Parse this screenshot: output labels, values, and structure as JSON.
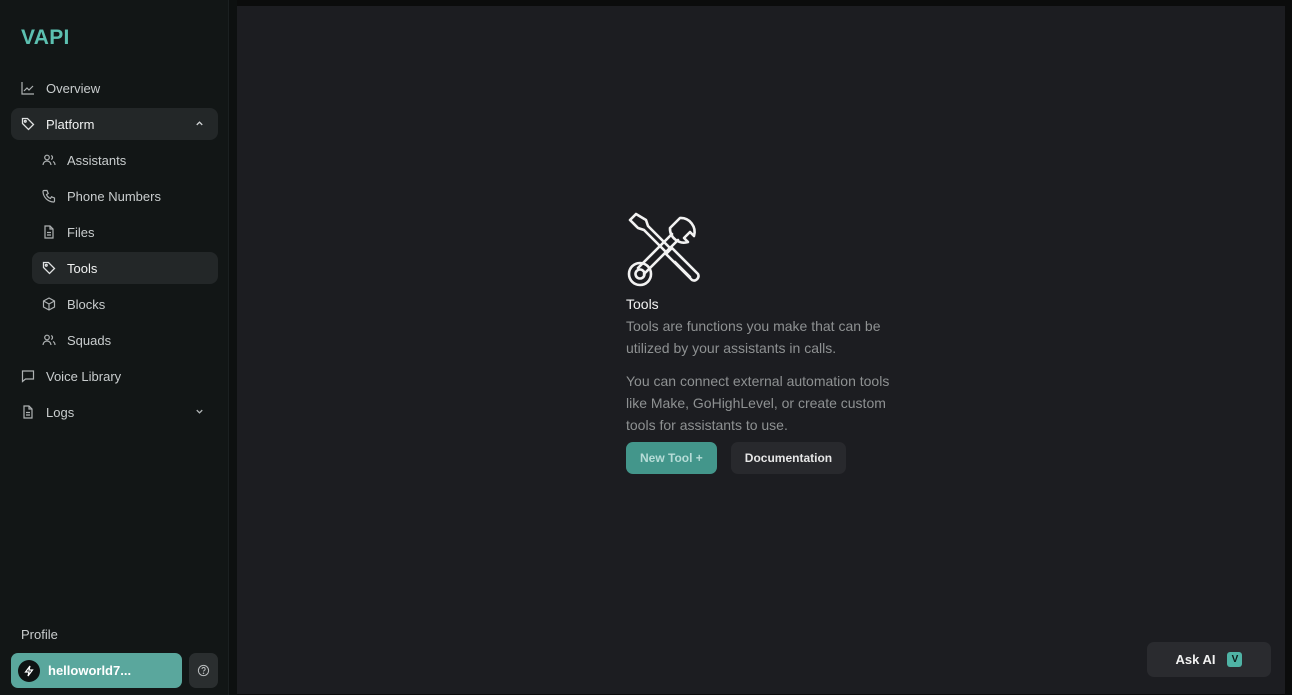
{
  "brand": {
    "name": "VAPI",
    "color": "#5cc0b0"
  },
  "sidebar": {
    "items": [
      {
        "label": "Overview",
        "icon": "chart-line-icon"
      },
      {
        "label": "Platform",
        "icon": "tag-icon",
        "expanded": true
      },
      {
        "label": "Assistants",
        "icon": "users-icon"
      },
      {
        "label": "Phone Numbers",
        "icon": "phone-icon"
      },
      {
        "label": "Files",
        "icon": "file-icon"
      },
      {
        "label": "Tools",
        "icon": "tag-icon",
        "active": true
      },
      {
        "label": "Blocks",
        "icon": "cube-icon"
      },
      {
        "label": "Squads",
        "icon": "users-icon"
      },
      {
        "label": "Voice Library",
        "icon": "message-square-icon"
      },
      {
        "label": "Logs",
        "icon": "file-icon",
        "expanded": false
      }
    ],
    "profile_label": "Profile",
    "username": "helloworld7..."
  },
  "empty_state": {
    "title": "Tools",
    "description": "Tools are functions you make that can be utilized by your assistants in calls.",
    "description2": "You can connect external automation tools like Make, GoHighLevel, or create custom tools for assistants to use.",
    "primary_button": "New Tool +",
    "secondary_button": "Documentation"
  },
  "ask_ai": {
    "label": "Ask AI",
    "badge": "V"
  }
}
